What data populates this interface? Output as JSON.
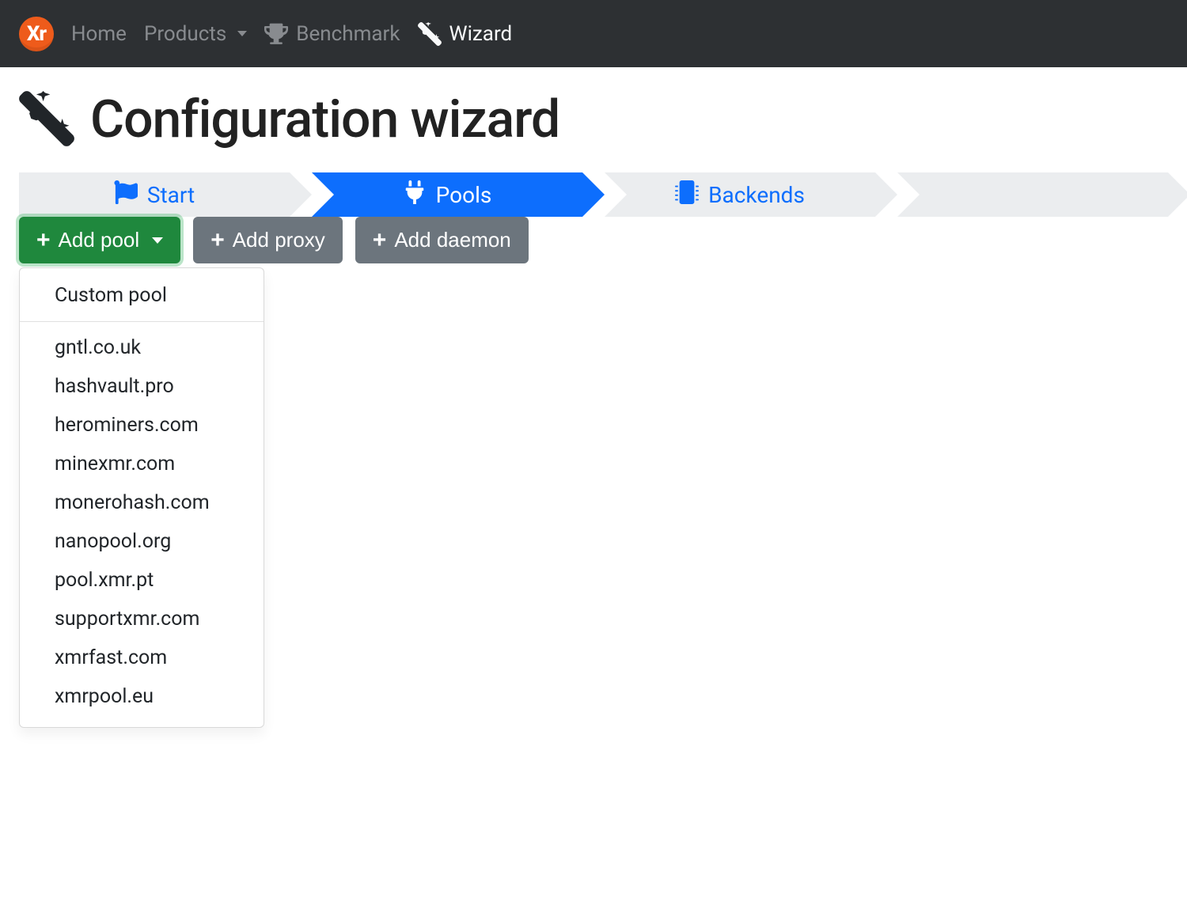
{
  "brand": {
    "text": "Xr"
  },
  "nav": {
    "home": {
      "label": "Home"
    },
    "products": {
      "label": "Products"
    },
    "benchmark": {
      "label": "Benchmark"
    },
    "wizard": {
      "label": "Wizard"
    }
  },
  "page_title": "Configuration wizard",
  "steps": {
    "start": {
      "label": "Start"
    },
    "pools": {
      "label": "Pools"
    },
    "backends": {
      "label": "Backends"
    }
  },
  "buttons": {
    "add_pool": "Add pool",
    "add_proxy": "Add proxy",
    "add_daemon": "Add daemon"
  },
  "add_pool_dropdown": {
    "custom": "Custom pool",
    "items": [
      "gntl.co.uk",
      "hashvault.pro",
      "herominers.com",
      "minexmr.com",
      "monerohash.com",
      "nanopool.org",
      "pool.xmr.pt",
      "supportxmr.com",
      "xmrfast.com",
      "xmrpool.eu"
    ]
  }
}
